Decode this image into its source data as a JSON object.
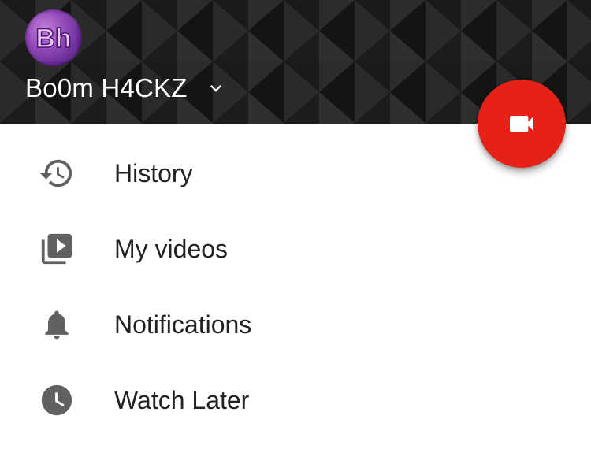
{
  "header": {
    "account_name": "Bo0m H4CKZ",
    "avatar_initials": "Bh",
    "background_color": "#1b1b1b"
  },
  "fab": {
    "icon": "videocam-icon",
    "color": "#e62117"
  },
  "menu": {
    "items": [
      {
        "label": "History",
        "icon": "history-icon"
      },
      {
        "label": "My videos",
        "icon": "my-videos-icon"
      },
      {
        "label": "Notifications",
        "icon": "bell-icon"
      },
      {
        "label": "Watch Later",
        "icon": "clock-icon"
      }
    ]
  },
  "colors": {
    "icon_gray": "#616161",
    "text": "#212121",
    "accent_red": "#e62117"
  }
}
